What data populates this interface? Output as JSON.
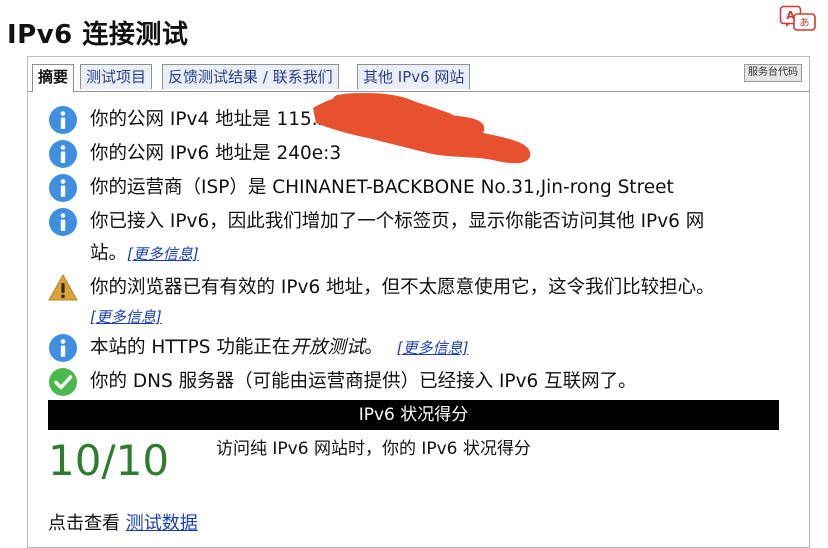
{
  "page": {
    "title": "IPv6 连接测试"
  },
  "tabs": [
    {
      "label": "摘要"
    },
    {
      "label": "测试项目"
    },
    {
      "label": "反馈测试结果 / 联系我们"
    },
    {
      "label": "其他 IPv6 网站"
    }
  ],
  "helpdesk_label": "服务台代码",
  "results": {
    "ipv4": {
      "icon": "info-icon",
      "text": "你的公网 IPv4 地址是 115.20"
    },
    "ipv6": {
      "icon": "info-icon",
      "text": "你的公网 IPv6 地址是 240e:3"
    },
    "isp": {
      "icon": "info-icon",
      "text": "你的运营商（ISP）是 CHINANET-BACKBONE No.31,Jin-rong Street"
    },
    "ipv6_tab": {
      "icon": "info-icon",
      "line1": "你已接入 IPv6，因此我们增加了一个标签页，显示你能否访问其他 IPv6 网",
      "line2": "站。",
      "link": "[更多信息]"
    },
    "browser_warning": {
      "icon": "warning-icon",
      "line1": "你的浏览器已有有效的 IPv6 地址，但不太愿意使用它，这令我们比较担心。",
      "link": "[更多信息]"
    },
    "https": {
      "icon": "info-icon",
      "prefix": "本站的 HTTPS 功能正在",
      "emphasis": "开放测试",
      "suffix": "。",
      "link": "[更多信息]"
    },
    "dns": {
      "icon": "check-icon",
      "text": "你的 DNS 服务器（可能由运营商提供）已经接入 IPv6 互联网了。"
    }
  },
  "score": {
    "bar_label": "IPv6 状况得分",
    "value": "10/10",
    "description": "访问纯 IPv6 网站时，你的 IPv6 状况得分"
  },
  "footer": {
    "prefix": "点击查看",
    "link": "测试数据"
  },
  "colors": {
    "info": "#3f8fe0",
    "warning": "#d9a33b",
    "check": "#4bb84b",
    "link": "#1a3fb5",
    "score": "#2e7d2e",
    "redaction": "#e8502f"
  }
}
